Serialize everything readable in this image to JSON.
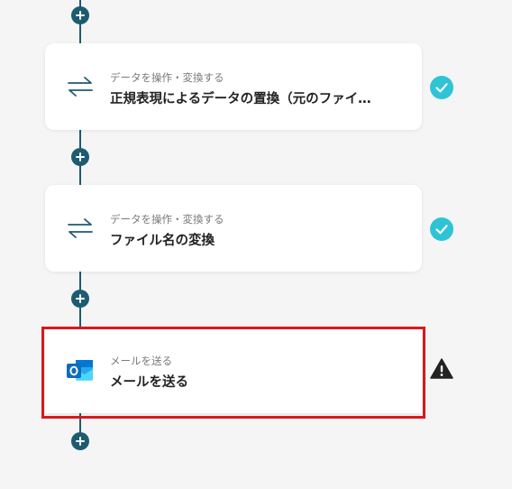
{
  "flow": {
    "steps": [
      {
        "category": "データを操作・変換する",
        "title": "正規表現によるデータの置換（元のファイ…",
        "icon": "swap-arrows-icon",
        "status": "completed"
      },
      {
        "category": "データを操作・変換する",
        "title": "ファイル名の変換",
        "icon": "swap-arrows-icon",
        "status": "completed"
      },
      {
        "category": "メールを送る",
        "title": "メールを送る",
        "icon": "outlook-icon",
        "status": "warning"
      }
    ],
    "add_step_icon": "plus-icon"
  },
  "colors": {
    "connector": "#1d5c70",
    "check": "#2ec4d6",
    "warning": "#222222",
    "highlight": "#d7191c",
    "swap_icon": "#1d5c70",
    "outlook_blue": "#0f6cbd"
  }
}
